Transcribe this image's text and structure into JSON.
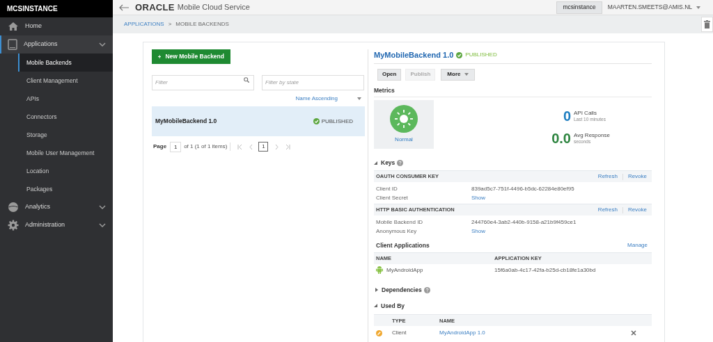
{
  "sidebar": {
    "title": "MCSINSTANCE",
    "items": [
      {
        "label": "Home",
        "kind": "home",
        "selected": false,
        "expandable": false
      },
      {
        "label": "Applications",
        "kind": "applications",
        "selected": true,
        "expandable": true,
        "expanded": true,
        "children": [
          {
            "label": "Mobile Backends",
            "selected": true
          },
          {
            "label": "Client Management",
            "selected": false
          },
          {
            "label": "APIs",
            "selected": false
          },
          {
            "label": "Connectors",
            "selected": false
          },
          {
            "label": "Storage",
            "selected": false
          },
          {
            "label": "Mobile User Management",
            "selected": false
          },
          {
            "label": "Location",
            "selected": false
          },
          {
            "label": "Packages",
            "selected": false
          }
        ]
      },
      {
        "label": "Analytics",
        "kind": "analytics",
        "selected": false,
        "expandable": true
      },
      {
        "label": "Administration",
        "kind": "administration",
        "selected": false,
        "expandable": true
      }
    ]
  },
  "header": {
    "logo": "ORACLE",
    "product": "Mobile Cloud Service",
    "instance": "mcsinstance",
    "user": "MAARTEN.SMEETS@AMIS.NL"
  },
  "breadcrumb": {
    "separator": ">",
    "items": [
      {
        "label": "APPLICATIONS",
        "link": true
      },
      {
        "label": "MOBILE BACKENDS",
        "link": false
      }
    ]
  },
  "backends": {
    "new_button": "New Mobile Backend",
    "filter_placeholder": "Filter",
    "state_placeholder": "Filter by state",
    "sort": "Name Ascending",
    "items": [
      {
        "name": "MyMobileBackend 1.0",
        "status": "PUBLISHED",
        "selected": true
      }
    ],
    "pager": {
      "label": "Page",
      "value": "1",
      "total": "of 1 (1 of 1 items)",
      "current": "1"
    }
  },
  "detail": {
    "title": "MyMobileBackend 1.0",
    "status": "PUBLISHED",
    "buttons": [
      {
        "label": "Open",
        "disabled": false,
        "kind": "button"
      },
      {
        "label": "Publish",
        "disabled": true,
        "kind": "button"
      },
      {
        "label": "More",
        "disabled": false,
        "kind": "menu"
      }
    ],
    "metrics": {
      "heading": "Metrics",
      "health": "Normal",
      "stats": [
        {
          "value": "0",
          "label": "API Calls",
          "sub": "Last 10 minutes",
          "color": "#1f7ec1"
        },
        {
          "value": "0.0",
          "label": "Avg Response",
          "sub": "seconds",
          "color": "#2e8540"
        }
      ]
    },
    "keys": {
      "heading": "Keys",
      "expanded": true,
      "groups": [
        {
          "title": "OAUTH CONSUMER KEY",
          "actions": [
            "Refresh",
            "Revoke"
          ],
          "rows": [
            {
              "label": "Client ID",
              "value": "839ad5c7-751f-4496-b5dc-62284e80ef95",
              "kind": "text"
            },
            {
              "label": "Client Secret",
              "value": "Show",
              "kind": "link"
            }
          ]
        },
        {
          "title": "HTTP BASIC AUTHENTICATION",
          "actions": [
            "Refresh",
            "Revoke"
          ],
          "rows": [
            {
              "label": "Mobile Backend ID",
              "value": "244760e4-3ab2-440b-9158-a21b9f459ce1",
              "kind": "text"
            },
            {
              "label": "Anonymous Key",
              "value": "Show",
              "kind": "link"
            }
          ]
        }
      ]
    },
    "client_applications": {
      "heading": "Client Applications",
      "action": "Manage",
      "columns": [
        "NAME",
        "APPLICATION KEY"
      ],
      "rows": [
        {
          "name": "MyAndroidApp",
          "key": "15f6a0ab-4c17-42fa-b25d-cb18fe1a30bd"
        }
      ]
    },
    "dependencies": {
      "heading": "Dependencies",
      "expanded": false
    },
    "used_by": {
      "heading": "Used By",
      "expanded": true,
      "columns": [
        "TYPE",
        "NAME"
      ],
      "rows": [
        {
          "type": "Client",
          "name": "MyAndroidApp 1.0"
        }
      ]
    }
  }
}
